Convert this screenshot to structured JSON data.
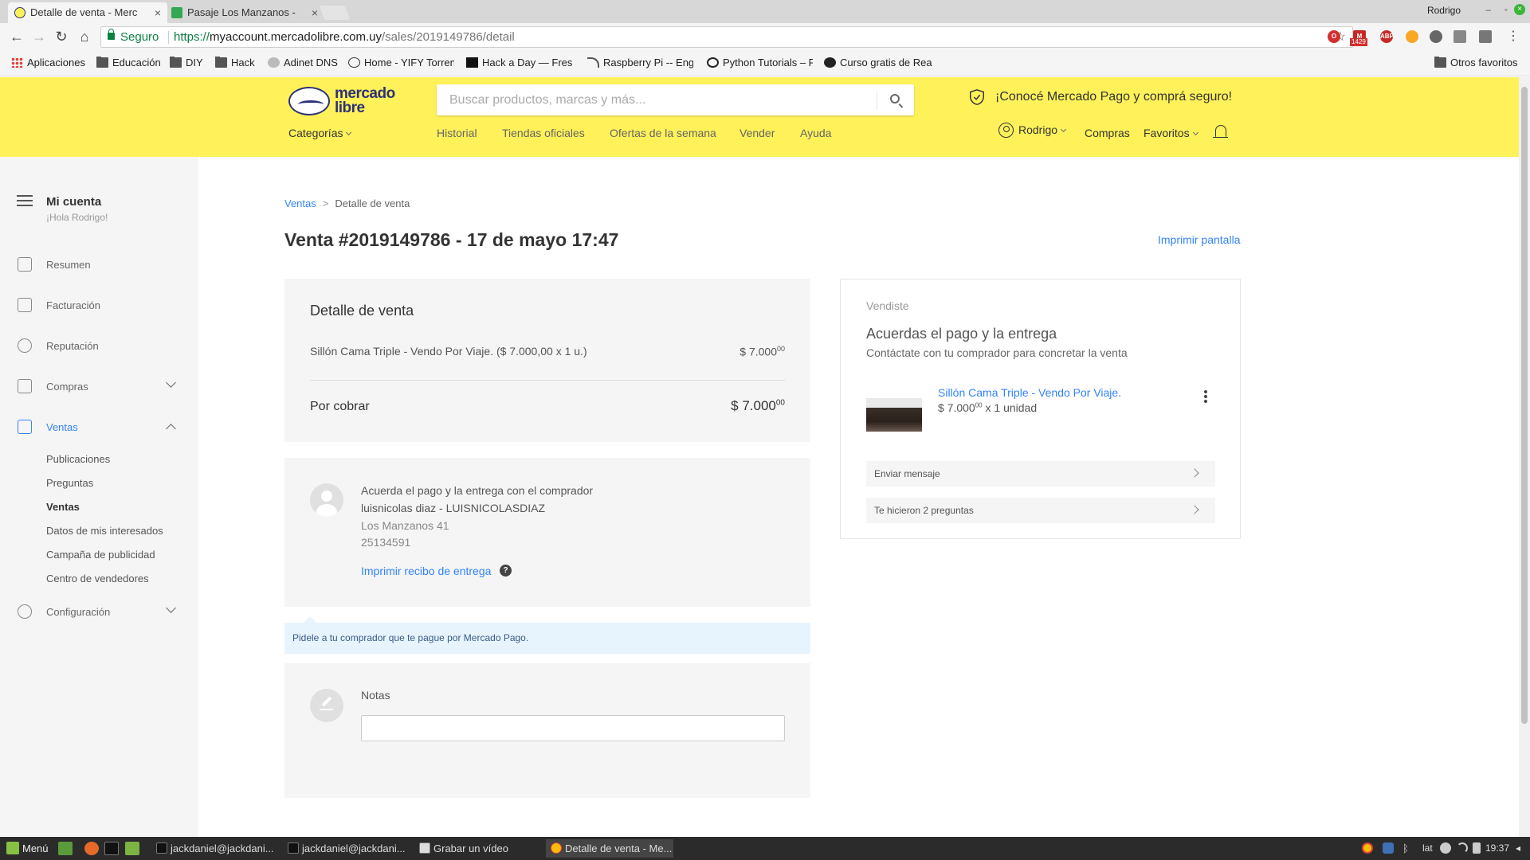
{
  "browser": {
    "tabs": [
      {
        "title": "Detalle de venta - Merc",
        "active": true
      },
      {
        "title": "Pasaje Los Manzanos - ",
        "active": false
      }
    ],
    "profile_name": "Rodrigo",
    "omnibox": {
      "secure_label": "Seguro",
      "scheme": "https://",
      "host": "myaccount.mercadolibre.com.uy",
      "path": "/sales/2019149786/detail"
    },
    "ext_badge": "1429",
    "bookmarks": [
      "Aplicaciones",
      "Educación",
      "DIY",
      "Hack",
      "Adinet DNS",
      "Home - YIFY Torrent",
      "Hack a Day — Fresh",
      "Raspberry Pi -- Enga",
      "Python Tutorials – R",
      "Curso gratis de Rea"
    ],
    "other_bookmarks": "Otros favoritos"
  },
  "header": {
    "logo_line1": "mercado",
    "logo_line2": "libre",
    "search_placeholder": "Buscar productos, marcas y más...",
    "promo": "¡Conocé Mercado Pago y comprá seguro!",
    "categories": "Categorías",
    "nav": [
      "Historial",
      "Tiendas oficiales",
      "Ofertas de la semana",
      "Vender",
      "Ayuda"
    ],
    "user": "Rodrigo",
    "purchases": "Compras",
    "favorites": "Favoritos",
    "brand_color": "#fff159"
  },
  "sidebar": {
    "title": "Mi cuenta",
    "greeting": "¡Hola Rodrigo!",
    "items": [
      "Resumen",
      "Facturación",
      "Reputación",
      "Compras",
      "Ventas",
      "Configuración"
    ],
    "sales_subitems": [
      "Publicaciones",
      "Preguntas",
      "Ventas",
      "Datos de mis interesados",
      "Campaña de publicidad",
      "Centro de vendedores"
    ]
  },
  "main": {
    "breadcrumb_root": "Ventas",
    "breadcrumb_sep": ">",
    "breadcrumb_current": "Detalle de venta",
    "title": "Venta #2019149786 - 17 de mayo 17:47",
    "print_screen": "Imprimir pantalla",
    "detail": {
      "heading": "Detalle de venta",
      "item": "Sillón Cama Triple - Vendo Por Viaje. ($ 7.000,00 x 1 u.)",
      "item_amount": "$ 7.000",
      "item_cents": "00",
      "to_collect_label": "Por cobrar",
      "to_collect_amount": "$ 7.000",
      "to_collect_cents": "00"
    },
    "buyer": {
      "instruction": "Acuerda el pago y la entrega con el comprador",
      "name": "luisnicolas diaz - LUISNICOLASDIAZ",
      "address": "Los Manzanos 41",
      "phone": "25134591",
      "print_receipt": "Imprimir recibo de entrega",
      "help": "?"
    },
    "banner": "Pidele a tu comprador que te pague por Mercado Pago.",
    "notes": {
      "label": "Notas",
      "value": ""
    }
  },
  "side": {
    "label": "Vendiste",
    "heading": "Acuerdas el pago y la entrega",
    "subheading": "Contáctate con tu comprador para concretar la venta",
    "item_title": "Sillón Cama Triple - Vendo Por Viaje.",
    "item_price": "$ 7.000",
    "item_cents": "00",
    "item_qty": "x 1 unidad",
    "actions": [
      "Enviar mensaje",
      "Te hicieron 2 preguntas"
    ]
  },
  "taskbar": {
    "menu": "Menú",
    "tasks": [
      "jackdaniel@jackdani...",
      "jackdaniel@jackdani...",
      "Grabar un vídeo",
      "Detalle de venta - Me..."
    ],
    "layout": "lat",
    "clock": "19:37"
  }
}
